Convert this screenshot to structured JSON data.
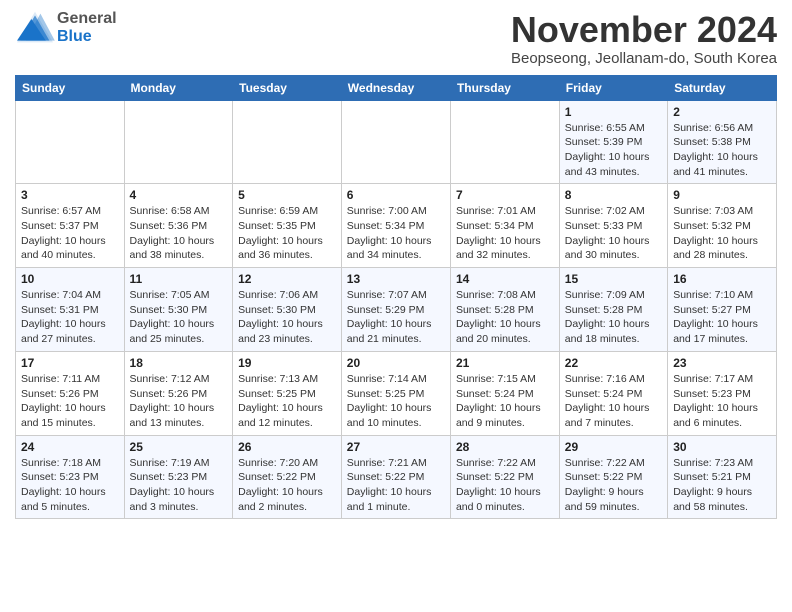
{
  "header": {
    "logo_general": "General",
    "logo_blue": "Blue",
    "month_title": "November 2024",
    "location": "Beopseong, Jeollanam-do, South Korea"
  },
  "days_of_week": [
    "Sunday",
    "Monday",
    "Tuesday",
    "Wednesday",
    "Thursday",
    "Friday",
    "Saturday"
  ],
  "weeks": [
    [
      {
        "day": "",
        "info": ""
      },
      {
        "day": "",
        "info": ""
      },
      {
        "day": "",
        "info": ""
      },
      {
        "day": "",
        "info": ""
      },
      {
        "day": "",
        "info": ""
      },
      {
        "day": "1",
        "info": "Sunrise: 6:55 AM\nSunset: 5:39 PM\nDaylight: 10 hours\nand 43 minutes."
      },
      {
        "day": "2",
        "info": "Sunrise: 6:56 AM\nSunset: 5:38 PM\nDaylight: 10 hours\nand 41 minutes."
      }
    ],
    [
      {
        "day": "3",
        "info": "Sunrise: 6:57 AM\nSunset: 5:37 PM\nDaylight: 10 hours\nand 40 minutes."
      },
      {
        "day": "4",
        "info": "Sunrise: 6:58 AM\nSunset: 5:36 PM\nDaylight: 10 hours\nand 38 minutes."
      },
      {
        "day": "5",
        "info": "Sunrise: 6:59 AM\nSunset: 5:35 PM\nDaylight: 10 hours\nand 36 minutes."
      },
      {
        "day": "6",
        "info": "Sunrise: 7:00 AM\nSunset: 5:34 PM\nDaylight: 10 hours\nand 34 minutes."
      },
      {
        "day": "7",
        "info": "Sunrise: 7:01 AM\nSunset: 5:34 PM\nDaylight: 10 hours\nand 32 minutes."
      },
      {
        "day": "8",
        "info": "Sunrise: 7:02 AM\nSunset: 5:33 PM\nDaylight: 10 hours\nand 30 minutes."
      },
      {
        "day": "9",
        "info": "Sunrise: 7:03 AM\nSunset: 5:32 PM\nDaylight: 10 hours\nand 28 minutes."
      }
    ],
    [
      {
        "day": "10",
        "info": "Sunrise: 7:04 AM\nSunset: 5:31 PM\nDaylight: 10 hours\nand 27 minutes."
      },
      {
        "day": "11",
        "info": "Sunrise: 7:05 AM\nSunset: 5:30 PM\nDaylight: 10 hours\nand 25 minutes."
      },
      {
        "day": "12",
        "info": "Sunrise: 7:06 AM\nSunset: 5:30 PM\nDaylight: 10 hours\nand 23 minutes."
      },
      {
        "day": "13",
        "info": "Sunrise: 7:07 AM\nSunset: 5:29 PM\nDaylight: 10 hours\nand 21 minutes."
      },
      {
        "day": "14",
        "info": "Sunrise: 7:08 AM\nSunset: 5:28 PM\nDaylight: 10 hours\nand 20 minutes."
      },
      {
        "day": "15",
        "info": "Sunrise: 7:09 AM\nSunset: 5:28 PM\nDaylight: 10 hours\nand 18 minutes."
      },
      {
        "day": "16",
        "info": "Sunrise: 7:10 AM\nSunset: 5:27 PM\nDaylight: 10 hours\nand 17 minutes."
      }
    ],
    [
      {
        "day": "17",
        "info": "Sunrise: 7:11 AM\nSunset: 5:26 PM\nDaylight: 10 hours\nand 15 minutes."
      },
      {
        "day": "18",
        "info": "Sunrise: 7:12 AM\nSunset: 5:26 PM\nDaylight: 10 hours\nand 13 minutes."
      },
      {
        "day": "19",
        "info": "Sunrise: 7:13 AM\nSunset: 5:25 PM\nDaylight: 10 hours\nand 12 minutes."
      },
      {
        "day": "20",
        "info": "Sunrise: 7:14 AM\nSunset: 5:25 PM\nDaylight: 10 hours\nand 10 minutes."
      },
      {
        "day": "21",
        "info": "Sunrise: 7:15 AM\nSunset: 5:24 PM\nDaylight: 10 hours\nand 9 minutes."
      },
      {
        "day": "22",
        "info": "Sunrise: 7:16 AM\nSunset: 5:24 PM\nDaylight: 10 hours\nand 7 minutes."
      },
      {
        "day": "23",
        "info": "Sunrise: 7:17 AM\nSunset: 5:23 PM\nDaylight: 10 hours\nand 6 minutes."
      }
    ],
    [
      {
        "day": "24",
        "info": "Sunrise: 7:18 AM\nSunset: 5:23 PM\nDaylight: 10 hours\nand 5 minutes."
      },
      {
        "day": "25",
        "info": "Sunrise: 7:19 AM\nSunset: 5:23 PM\nDaylight: 10 hours\nand 3 minutes."
      },
      {
        "day": "26",
        "info": "Sunrise: 7:20 AM\nSunset: 5:22 PM\nDaylight: 10 hours\nand 2 minutes."
      },
      {
        "day": "27",
        "info": "Sunrise: 7:21 AM\nSunset: 5:22 PM\nDaylight: 10 hours\nand 1 minute."
      },
      {
        "day": "28",
        "info": "Sunrise: 7:22 AM\nSunset: 5:22 PM\nDaylight: 10 hours\nand 0 minutes."
      },
      {
        "day": "29",
        "info": "Sunrise: 7:22 AM\nSunset: 5:22 PM\nDaylight: 9 hours\nand 59 minutes."
      },
      {
        "day": "30",
        "info": "Sunrise: 7:23 AM\nSunset: 5:21 PM\nDaylight: 9 hours\nand 58 minutes."
      }
    ]
  ]
}
